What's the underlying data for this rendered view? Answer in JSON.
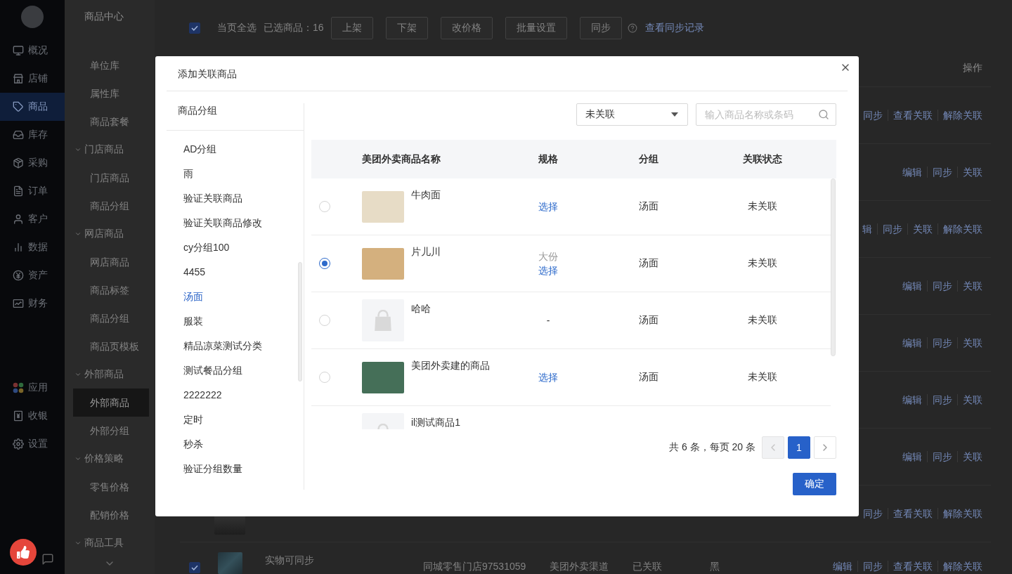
{
  "nav": {
    "items": [
      {
        "label": "概况",
        "selected": false
      },
      {
        "label": "店铺",
        "selected": false
      },
      {
        "label": "商品",
        "selected": true
      },
      {
        "label": "库存",
        "selected": false
      },
      {
        "label": "采购",
        "selected": false
      },
      {
        "label": "订单",
        "selected": false
      },
      {
        "label": "客户",
        "selected": false
      },
      {
        "label": "数据",
        "selected": false
      },
      {
        "label": "资产",
        "selected": false
      },
      {
        "label": "财务",
        "selected": false
      }
    ],
    "bottom_items": [
      {
        "label": "应用"
      },
      {
        "label": "收银"
      },
      {
        "label": "设置"
      }
    ]
  },
  "subnav": {
    "title": "商品中心",
    "items": [
      {
        "kind": "item",
        "label": "单位库",
        "selected": false
      },
      {
        "kind": "item",
        "label": "属性库",
        "selected": false
      },
      {
        "kind": "item",
        "label": "商品套餐",
        "selected": false
      },
      {
        "kind": "group",
        "label": "门店商品",
        "expanded": true,
        "children": [
          {
            "kind": "item",
            "label": "门店商品",
            "selected": false
          },
          {
            "kind": "item",
            "label": "商品分组",
            "selected": false
          }
        ]
      },
      {
        "kind": "group",
        "label": "网店商品",
        "expanded": true,
        "children": [
          {
            "kind": "item",
            "label": "网店商品",
            "selected": false
          },
          {
            "kind": "item",
            "label": "商品标签",
            "selected": false
          },
          {
            "kind": "item",
            "label": "商品分组",
            "selected": false
          },
          {
            "kind": "item",
            "label": "商品页模板",
            "selected": false
          }
        ]
      },
      {
        "kind": "group",
        "label": "外部商品",
        "expanded": true,
        "children": [
          {
            "kind": "item",
            "label": "外部商品",
            "selected": true
          },
          {
            "kind": "item",
            "label": "外部分组",
            "selected": false
          }
        ]
      },
      {
        "kind": "group",
        "label": "价格策略",
        "expanded": true,
        "children": [
          {
            "kind": "item",
            "label": "零售价格",
            "selected": false
          },
          {
            "kind": "item",
            "label": "配销价格",
            "selected": false
          }
        ]
      },
      {
        "kind": "group",
        "label": "商品工具",
        "expanded": true
      }
    ]
  },
  "toolbar": {
    "select_all": {
      "label": "当页全选",
      "checked": true
    },
    "selected_count": "已选商品：16",
    "buttons": [
      "上架",
      "下架",
      "改价格",
      "批量设置",
      "同步"
    ],
    "link": "查看同步记录"
  },
  "table": {
    "action_header": "操作",
    "rows": [
      {
        "actions": [
          "同步",
          "查看关联",
          "解除关联"
        ]
      },
      {
        "actions": [
          "编辑",
          "同步",
          "关联"
        ]
      },
      {
        "actions": [
          "辑",
          "同步",
          "关联",
          "解除关联"
        ]
      },
      {
        "actions": [
          "编辑",
          "同步",
          "关联"
        ]
      },
      {
        "actions": [
          "编辑",
          "同步",
          "关联"
        ]
      },
      {
        "actions": [
          "编辑",
          "同步",
          "关联"
        ]
      },
      {
        "actions": [
          "编辑",
          "同步",
          "关联"
        ]
      },
      {
        "thumbnail": {
          "kind": "photo"
        },
        "actions": [
          "同步",
          "查看关联",
          "解除关联"
        ]
      },
      {
        "checked": true,
        "thumbnail": {
          "kind": "photo"
        },
        "name": "实物可同步",
        "cells": [
          "同城零售门店97531059",
          "美团外卖渠道",
          "已关联",
          "黑"
        ],
        "actions": [
          "编辑",
          "同步",
          "查看关联",
          "解除关联"
        ]
      }
    ]
  },
  "modal": {
    "title": "添加关联商品",
    "groups": {
      "title": "商品分组",
      "items": [
        {
          "label": "AD分组",
          "selected": false
        },
        {
          "label": "雨",
          "selected": false
        },
        {
          "label": "验证关联商品",
          "selected": false
        },
        {
          "label": "验证关联商品修改",
          "selected": false
        },
        {
          "label": "cy分组100",
          "selected": false
        },
        {
          "label": "4455",
          "selected": false
        },
        {
          "label": "汤面",
          "selected": true
        },
        {
          "label": "服装",
          "selected": false
        },
        {
          "label": "精品凉菜测试分类",
          "selected": false
        },
        {
          "label": "测试餐品分组",
          "selected": false
        },
        {
          "label": "2222222",
          "selected": false
        },
        {
          "label": "定时",
          "selected": false
        },
        {
          "label": "秒杀",
          "selected": false
        },
        {
          "label": "验证分组数量",
          "selected": false
        }
      ]
    },
    "filter": {
      "value": "未关联"
    },
    "search": {
      "placeholder": "输入商品名称或条码"
    },
    "table": {
      "columns": [
        "美团外卖商品名称",
        "规格",
        "分组",
        "关联状态"
      ],
      "rows": [
        {
          "selected": false,
          "thumbnail": {
            "kind": "photo"
          },
          "name": "牛肉面",
          "spec": {
            "link": "选择"
          },
          "group": "汤面",
          "status": "未关联"
        },
        {
          "selected": true,
          "thumbnail": {
            "kind": "photo"
          },
          "name": "片儿川",
          "spec": {
            "value": "大份",
            "link": "选择"
          },
          "group": "汤面",
          "status": "未关联"
        },
        {
          "selected": false,
          "thumbnail": {
            "kind": "placeholder"
          },
          "name": "哈哈",
          "spec": {
            "value": "-"
          },
          "group": "汤面",
          "status": "未关联"
        },
        {
          "selected": false,
          "thumbnail": {
            "kind": "photo"
          },
          "name": "美团外卖建的商品",
          "spec": {
            "link": "选择"
          },
          "group": "汤面",
          "status": "未关联"
        },
        {
          "thumbnail": {
            "kind": "placeholder"
          },
          "name": "il测试商品1"
        }
      ]
    },
    "pagination": {
      "summary": "共 6 条，每页 20 条",
      "prev_disabled": true,
      "pages": [
        {
          "label": "1",
          "selected": true
        }
      ],
      "next_disabled": false
    },
    "confirm": "确定"
  }
}
